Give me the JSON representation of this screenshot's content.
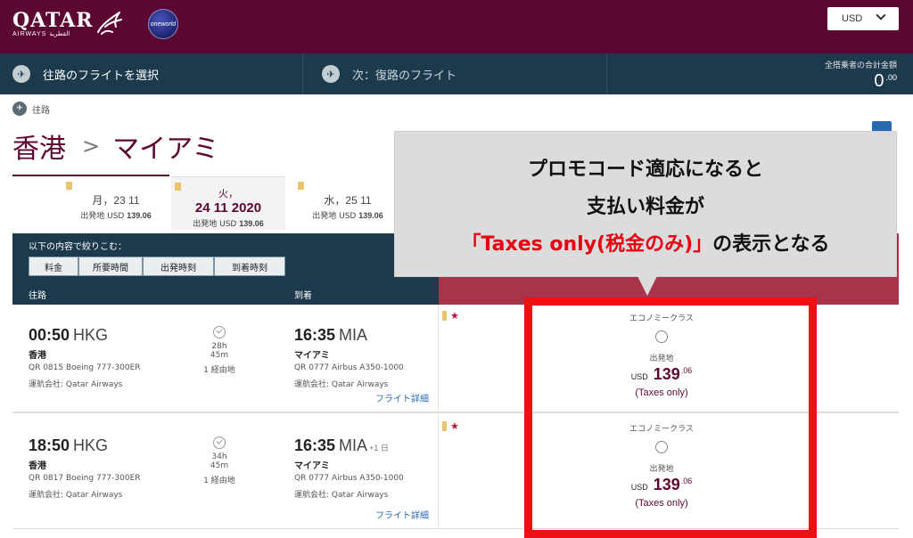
{
  "header": {
    "logo_main": "QATAR",
    "logo_sub": "AIRWAYS القطرية",
    "oneworld": "oneworld",
    "currency": "USD"
  },
  "steps": {
    "step1_label": "往路のフライトを選択",
    "step2_label": "次：復路のフライト",
    "total_label": "全搭乗者の合計金額",
    "total_value": "0",
    "total_cents": ".00"
  },
  "outbound_label": "往路",
  "route": {
    "origin": "香港",
    "separator": ">",
    "destination": "マイアミ"
  },
  "date_tabs": [
    {
      "date": "月，23 11",
      "price_label": "出発地 USD",
      "price": "139.06"
    },
    {
      "day": "火，",
      "date": "24 11 2020",
      "price_label": "出発地 USD",
      "price": "139.06"
    },
    {
      "date": "水，25 11",
      "price_label": "出発地 USD",
      "price": "139.06"
    }
  ],
  "filter": {
    "label": "以下の内容で絞りこむ：",
    "sort": [
      "料金",
      "所要時間",
      "出発時刻",
      "到着時刻"
    ]
  },
  "columns": {
    "departure": "往路",
    "arrival": "到着"
  },
  "flights": [
    {
      "dep_time": "00:50",
      "dep_code": "HKG",
      "dep_city": "香港",
      "flight": "QR 0815 Boeing 777-300ER",
      "operator": "運航会社: Qatar Airways",
      "duration": "28h 45m",
      "stops": "1 経由地",
      "arr_time": "16:35",
      "arr_code": "MIA",
      "arr_next": "",
      "arr_city": "マイアミ",
      "arr_flight": "QR 0777 Airbus A350-1000",
      "arr_operator": "運航会社: Qatar Airways",
      "details": "フライト詳細",
      "fare_class": "エコノミークラス",
      "from_label": "出発地",
      "currency": "USD",
      "price": "139",
      "cents": ".06",
      "taxes": "(Taxes only)"
    },
    {
      "dep_time": "18:50",
      "dep_code": "HKG",
      "dep_city": "香港",
      "flight": "QR 0817 Boeing 777-300ER",
      "operator": "運航会社: Qatar Airways",
      "duration": "34h 45m",
      "stops": "1 経由地",
      "arr_time": "16:35",
      "arr_code": "MIA",
      "arr_next": "+1 日",
      "arr_city": "マイアミ",
      "arr_flight": "QR 0777 Airbus A350-1000",
      "arr_operator": "運航会社: Qatar Airways",
      "details": "フライト詳細",
      "fare_class": "エコノミークラス",
      "from_label": "出発地",
      "currency": "USD",
      "price": "139",
      "cents": ".06",
      "taxes": "(Taxes only)"
    }
  ],
  "callout": {
    "line1": "プロモコード適応になると",
    "line2": "支払い料金が",
    "line3_red": "「Taxes only(税金のみ)」",
    "line3_rest": "の表示となる"
  },
  "colors": {
    "brand": "#5c0632",
    "nav": "#1c3a4c",
    "highlight": "#ee1111",
    "fare_band": "#a8344c"
  }
}
